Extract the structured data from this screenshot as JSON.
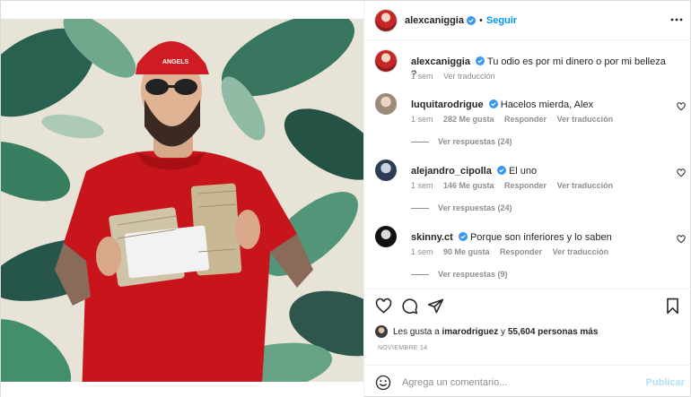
{
  "post": {
    "author": "alexcaniggia",
    "follow_label": "Seguir",
    "separator": "•",
    "caption": {
      "user": "alexcaniggia",
      "text": "Tu odio es por mi dinero o por mi belleza ?",
      "time": "1 sem",
      "translate": "Ver traducción"
    },
    "comments": [
      {
        "user": "luquitarodrigue",
        "text": "Hacelos mierda, Alex",
        "time": "1 sem",
        "likes": "282 Me gusta",
        "reply": "Responder",
        "translate": "Ver traducción",
        "replies": "Ver respuestas (24)"
      },
      {
        "user": "alejandro_cipolla",
        "text": "El uno",
        "time": "1 sem",
        "likes": "146 Me gusta",
        "reply": "Responder",
        "translate": "Ver traducción",
        "replies": "Ver respuestas (24)"
      },
      {
        "user": "skinny.ct",
        "text": "Porque son inferiores y lo saben",
        "time": "1 sem",
        "likes": "90 Me gusta",
        "reply": "Responder",
        "translate": "Ver traducción",
        "replies": "Ver respuestas (9)"
      }
    ],
    "likes_prefix": "Les gusta a",
    "likes_user": "imarodriguez",
    "likes_joiner": "y",
    "likes_count": "55,604 personas más",
    "date": "NOVIEMBRE 14",
    "comment_placeholder": "Agrega un comentario...",
    "publish_label": "Publicar"
  },
  "photo": {
    "cap_text": "ANGELS"
  },
  "colors": {
    "link": "#0095f6",
    "verified": "#3897f0",
    "muted": "#8e8e8e",
    "shirt": "#c8141b"
  },
  "icons": [
    "more-options-icon",
    "verified-badge-icon",
    "heart-icon",
    "comment-icon",
    "share-icon",
    "bookmark-icon",
    "emoji-icon"
  ]
}
